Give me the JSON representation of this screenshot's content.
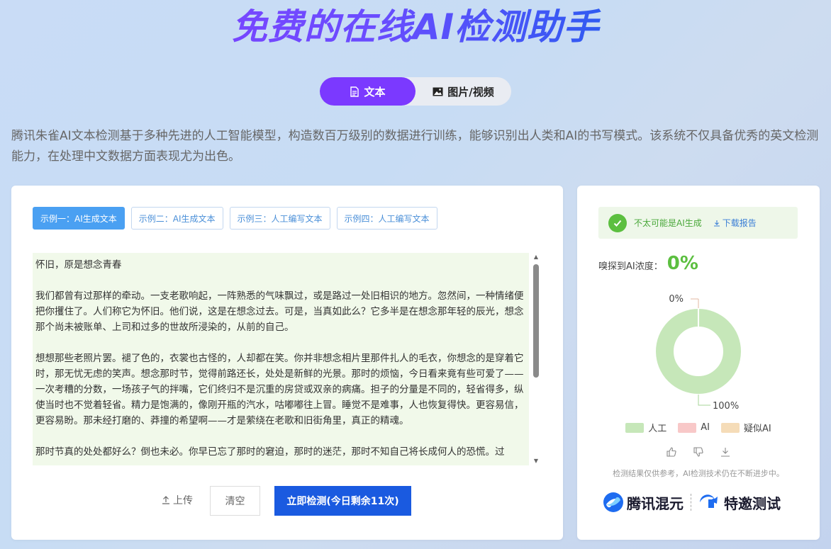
{
  "header": {
    "title": "免费的在线AI检测助手"
  },
  "mode_switch": {
    "text_tab": "文本",
    "image_tab": "图片/视频"
  },
  "intro": "腾讯朱雀AI文本检测基于多种先进的人工智能模型，构造数百万级别的数据进行训练，能够识别出人类和AI的书写模式。该系统不仅具备优秀的英文检测能力，在处理中文数据方面表现尤为出色。",
  "examples": [
    {
      "label": "示例一：AI生成文本",
      "active": true
    },
    {
      "label": "示例二：AI生成文本",
      "active": false
    },
    {
      "label": "示例三：人工编写文本",
      "active": false
    },
    {
      "label": "示例四：人工编写文本",
      "active": false
    }
  ],
  "textbox": {
    "paragraphs": [
      "怀旧，原是想念青春",
      "我们都曾有过那样的牵动。一支老歌响起，一阵熟悉的气味飘过，或是路过一处旧相识的地方。忽然间，一种情绪便把你攫住了。人们称它为怀旧。他们说，这是在想念过去。可是，当真如此么？它多半是在想念那年轻的辰光，想念那个尚未被账单、上司和过多的世故所浸染的，从前的自己。",
      "想想那些老照片罢。褪了色的，衣裳也古怪的，人却都在笑。你并非想念相片里那件扎人的毛衣，你想念的是穿着它时，那无忧无虑的笑声。想念那时节，觉得前路还长，处处是新鲜的光景。那时的烦恼，今日看来竟有些可爱了——一次考糟的分数，一场孩子气的拌嘴，它们终归不是沉重的房贷或双亲的病痛。担子的分量是不同的，轻省得多，纵使当时也不觉着轻省。精力是饱满的，像刚开瓶的汽水，咕嘟嘟往上冒。睡觉不是难事，人也恢复得快。更容易信，更容易盼。那未经打磨的、莽撞的希望啊——才是萦绕在老歌和旧街角里，真正的精魂。",
      "那时节真的处处都好么？倒也未必。你早已忘了那时的窘迫，那时的迷茫，那时不知自己将长成何人的恐慌。过"
    ]
  },
  "actions": {
    "upload": "上传",
    "clear": "清空",
    "detect": "立即检测(今日剩余11次)"
  },
  "result": {
    "verdict": "不太可能是AI生成",
    "download": "下载报告",
    "density_label": "嗅探到AI浓度：",
    "density_value": "0%",
    "chart_label_top": "0%",
    "chart_label_bottom": "100%",
    "disclaimer": "检测结果仅供参考，AI检测技术仍在不断进步中。"
  },
  "chart_data": {
    "type": "pie",
    "categories": [
      "人工",
      "AI",
      "疑似AI"
    ],
    "values": [
      100,
      0,
      0
    ],
    "colors": [
      "#c6e7b9",
      "#f8c8c8",
      "#f5dcb8"
    ],
    "legend": "bottom"
  },
  "brands": {
    "left": "腾讯混元",
    "right": "特邀测试"
  },
  "colors": {
    "accent": "#7b39ff",
    "primary": "#1a5ae0",
    "success": "#5cbf40",
    "link": "#3a7ed6"
  }
}
